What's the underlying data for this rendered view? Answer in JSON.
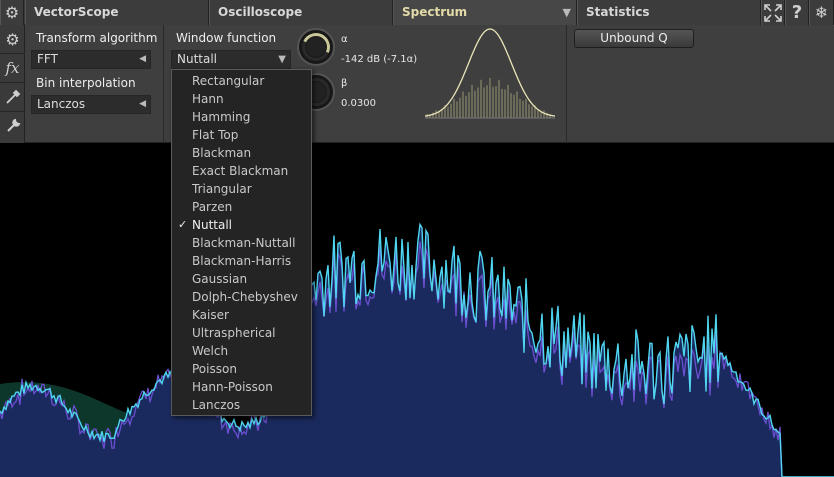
{
  "tabs": [
    {
      "label": "VectorScope",
      "active": false
    },
    {
      "label": "Oscilloscope",
      "active": false
    },
    {
      "label": "Spectrum",
      "active": true
    },
    {
      "label": "Statistics",
      "active": false
    }
  ],
  "tab_dropdown_arrow": "▼",
  "window_icons": [
    "fullscreen-icon",
    "help-icon",
    "snowflake-icon"
  ],
  "left_icons": [
    "gear-icon",
    "fx-icon",
    "eyedropper-icon",
    "wrench-icon"
  ],
  "transform": {
    "label": "Transform algorithm",
    "value": "FFT"
  },
  "bin_interp": {
    "label": "Bin interpolation",
    "value": "Lanczos"
  },
  "window_fn": {
    "label": "Window function",
    "value": "Nuttall"
  },
  "alpha": {
    "symbol": "α",
    "value": "-142 dB (-7.1α)"
  },
  "beta": {
    "symbol": "β",
    "value": "0.0300"
  },
  "unbound_q": "Unbound Q",
  "dropdown": {
    "selected": "Nuttall",
    "check_mark": "✓",
    "options": [
      "Rectangular",
      "Hann",
      "Hamming",
      "Flat Top",
      "Blackman",
      "Exact Blackman",
      "Triangular",
      "Parzen",
      "Nuttall",
      "Blackman-Nuttall",
      "Blackman-Harris",
      "Gaussian",
      "Dolph-Chebyshev",
      "Kaiser",
      "Ultraspherical",
      "Welch",
      "Poisson",
      "Hann-Poisson",
      "Lanczos"
    ]
  },
  "colors": {
    "accent_tab": "#e2dba8",
    "spectrum_fill": "#1b2a5e",
    "spectrum_line_cyan": "#4fd6f0",
    "spectrum_line_violet": "#6a4fd0",
    "preview_curve": "#eae5b8"
  }
}
